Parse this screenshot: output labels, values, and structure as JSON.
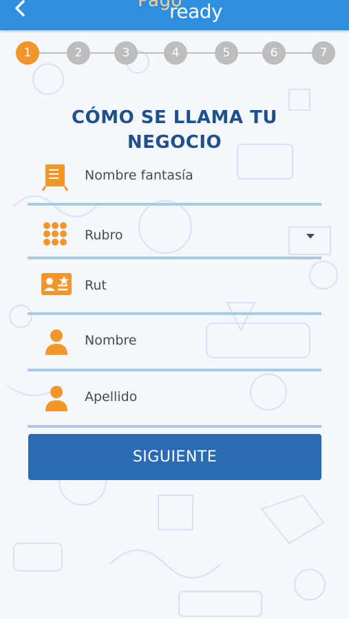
{
  "header": {
    "logo_top": "Pago",
    "logo_main": "ready",
    "brand_color": "#2e8fe0"
  },
  "stepper": {
    "current": 1,
    "steps": [
      "1",
      "2",
      "3",
      "4",
      "5",
      "6",
      "7"
    ],
    "active_color": "#f2962b",
    "inactive_color": "#bdbdbd"
  },
  "form": {
    "title_line1": "CÓMO SE LLAMA TU",
    "title_line2": "NEGOCIO",
    "fields": [
      {
        "placeholder": "Nombre fantasía",
        "icon": "signboard-icon"
      },
      {
        "placeholder": "Rubro",
        "icon": "grid-icon",
        "type": "select"
      },
      {
        "placeholder": "Rut",
        "icon": "id-card-icon"
      },
      {
        "placeholder": "Nombre",
        "icon": "person-icon"
      },
      {
        "placeholder": "Apellido",
        "icon": "person-icon"
      }
    ],
    "submit_label": "SIGUIENTE",
    "accent_color": "#f2962b",
    "button_color": "#2a6bb3"
  }
}
